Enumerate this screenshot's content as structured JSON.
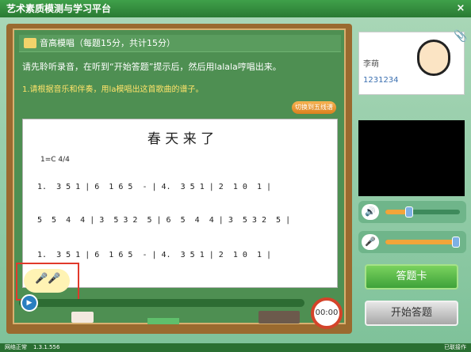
{
  "window": {
    "title": "艺术素质模测与学习平台",
    "close": "×"
  },
  "lesson": {
    "title": "音高模唱（每题15分，共计15分）",
    "instruction": "请先聆听录音，在听到“开始答题”提示后，然后用lalala哼唱出来。",
    "tip": "1.请根据音乐和伴奏，用la模唱出这首歌曲的谱子。",
    "switch_label": "切换到五线谱"
  },
  "sheet": {
    "song_title": "春 天 来 了",
    "key": "1=C 4/4",
    "rows": [
      "1.  3 5 1 | 6  1 6 5  - | 4.  3 5 1 | 2  1 0  1 |",
      "5  5  4  4 | 3  5 3 2  5 | 6  5  4  4 | 3  5 3 2  5 |",
      "1.  3 5 1 | 6  1 6 5  - | 4.  3 5 1 | 2  1 0  1 |"
    ]
  },
  "player": {
    "play_icon": "▶",
    "timer": "00:00"
  },
  "student": {
    "name": "李萌",
    "id": "1231234"
  },
  "controls": {
    "volume_level": 0.32,
    "mic_level": 0.96,
    "volume_icon": "speaker-icon",
    "mic_icon": "microphone-icon",
    "sheet_button": "答题卡",
    "start_button": "开始答题"
  },
  "status": {
    "left": "网络正常",
    "version": "1.3.1.556",
    "right": "已联接作"
  },
  "colors": {
    "accent_orange": "#f2a53a",
    "board_green": "#4e8f52",
    "button_green": "#3ea23a"
  }
}
